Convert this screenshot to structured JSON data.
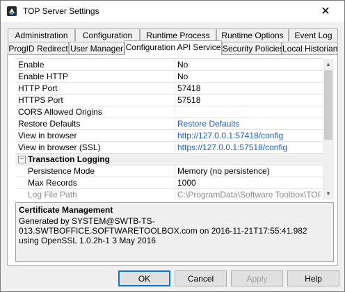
{
  "window": {
    "title": "TOP Server Settings",
    "close_glyph": "✕"
  },
  "tabs_back": [
    "Administration",
    "Configuration",
    "Runtime Process",
    "Runtime Options",
    "Event Log"
  ],
  "tabs_front": [
    "ProgID Redirect",
    "User Manager",
    "Configuration API Service",
    "Security Policies",
    "Local Historian"
  ],
  "active_tab": "Configuration API Service",
  "grid": {
    "rows": [
      {
        "name": "Enable",
        "value": "No"
      },
      {
        "name": "Enable HTTP",
        "value": "No"
      },
      {
        "name": "HTTP Port",
        "value": "57418"
      },
      {
        "name": "HTTPS Port",
        "value": "57518"
      },
      {
        "name": "CORS Allowed Origins",
        "value": ""
      },
      {
        "name": "Restore Defaults",
        "value": "Restore Defaults"
      },
      {
        "name": "View in browser",
        "value": "http://127.0.0.1:57418/config"
      },
      {
        "name": "View in browser (SSL)",
        "value": "https://127.0.0.1:57518/config"
      }
    ],
    "group": {
      "label": "Transaction Logging",
      "toggle": "−"
    },
    "group_rows": [
      {
        "name": "Persistence Mode",
        "value": "Memory (no persistence)"
      },
      {
        "name": "Max Records",
        "value": "1000"
      },
      {
        "name": "Log File Path",
        "value": "C:\\ProgramData\\Software Toolbox\\TOP..."
      }
    ]
  },
  "description": {
    "title": "Certificate Management",
    "text": "Generated by SYSTEM@SWTB-TS-013.SWTBOFFICE.SOFTWARETOOLBOX.com on 2016-11-21T17:55:41.982 using OpenSSL 1.0.2h-1  3 May 2016"
  },
  "buttons": {
    "ok": "OK",
    "cancel": "Cancel",
    "apply": "Apply",
    "help": "Help"
  },
  "icons": {
    "app": "top-server-icon",
    "scroll_up": "▲",
    "scroll_down": "▼"
  },
  "colors": {
    "link": "#1a5fc7",
    "accent": "#0078d7"
  }
}
